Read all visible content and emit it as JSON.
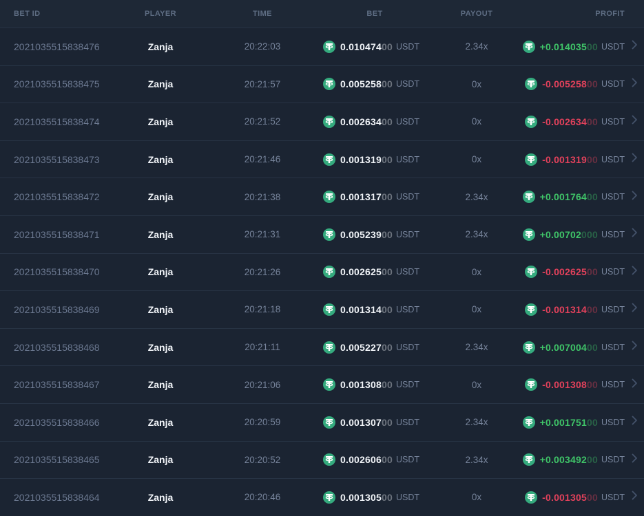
{
  "table": {
    "columns": [
      {
        "key": "bet_id",
        "label": "BET ID"
      },
      {
        "key": "player",
        "label": "PLAYER"
      },
      {
        "key": "time",
        "label": "TIME"
      },
      {
        "key": "bet",
        "label": "BET"
      },
      {
        "key": "payout",
        "label": "PAYOUT"
      },
      {
        "key": "profit",
        "label": "PROFIT"
      }
    ],
    "rows": [
      {
        "id": "2021035515838476",
        "player": "Zanja",
        "time": "20:22:03",
        "bet_main": "0.010474",
        "bet_zeros": "00",
        "payout": "2.34x",
        "profit_main": "+0.014035",
        "profit_zeros": "00",
        "currency": "USDT"
      },
      {
        "id": "2021035515838475",
        "player": "Zanja",
        "time": "20:21:57",
        "bet_main": "0.005258",
        "bet_zeros": "00",
        "payout": "0x",
        "profit_main": "-0.005258",
        "profit_zeros": "00",
        "currency": "USDT"
      },
      {
        "id": "2021035515838474",
        "player": "Zanja",
        "time": "20:21:52",
        "bet_main": "0.002634",
        "bet_zeros": "00",
        "payout": "0x",
        "profit_main": "-0.002634",
        "profit_zeros": "00",
        "currency": "USDT"
      },
      {
        "id": "2021035515838473",
        "player": "Zanja",
        "time": "20:21:46",
        "bet_main": "0.001319",
        "bet_zeros": "00",
        "payout": "0x",
        "profit_main": "-0.001319",
        "profit_zeros": "00",
        "currency": "USDT"
      },
      {
        "id": "2021035515838472",
        "player": "Zanja",
        "time": "20:21:38",
        "bet_main": "0.001317",
        "bet_zeros": "00",
        "payout": "2.34x",
        "profit_main": "+0.001764",
        "profit_zeros": "00",
        "currency": "USDT"
      },
      {
        "id": "2021035515838471",
        "player": "Zanja",
        "time": "20:21:31",
        "bet_main": "0.005239",
        "bet_zeros": "00",
        "payout": "2.34x",
        "profit_main": "+0.00702",
        "profit_zeros": "000",
        "currency": "USDT"
      },
      {
        "id": "2021035515838470",
        "player": "Zanja",
        "time": "20:21:26",
        "bet_main": "0.002625",
        "bet_zeros": "00",
        "payout": "0x",
        "profit_main": "-0.002625",
        "profit_zeros": "00",
        "currency": "USDT"
      },
      {
        "id": "2021035515838469",
        "player": "Zanja",
        "time": "20:21:18",
        "bet_main": "0.001314",
        "bet_zeros": "00",
        "payout": "0x",
        "profit_main": "-0.001314",
        "profit_zeros": "00",
        "currency": "USDT"
      },
      {
        "id": "2021035515838468",
        "player": "Zanja",
        "time": "20:21:11",
        "bet_main": "0.005227",
        "bet_zeros": "00",
        "payout": "2.34x",
        "profit_main": "+0.007004",
        "profit_zeros": "00",
        "currency": "USDT"
      },
      {
        "id": "2021035515838467",
        "player": "Zanja",
        "time": "20:21:06",
        "bet_main": "0.001308",
        "bet_zeros": "00",
        "payout": "0x",
        "profit_main": "-0.001308",
        "profit_zeros": "00",
        "currency": "USDT"
      },
      {
        "id": "2021035515838466",
        "player": "Zanja",
        "time": "20:20:59",
        "bet_main": "0.001307",
        "bet_zeros": "00",
        "payout": "2.34x",
        "profit_main": "+0.001751",
        "profit_zeros": "00",
        "currency": "USDT"
      },
      {
        "id": "2021035515838465",
        "player": "Zanja",
        "time": "20:20:52",
        "bet_main": "0.002606",
        "bet_zeros": "00",
        "payout": "2.34x",
        "profit_main": "+0.003492",
        "profit_zeros": "00",
        "currency": "USDT"
      },
      {
        "id": "2021035515838464",
        "player": "Zanja",
        "time": "20:20:46",
        "bet_main": "0.001305",
        "bet_zeros": "00",
        "payout": "0x",
        "profit_main": "-0.001305",
        "profit_zeros": "00",
        "currency": "USDT"
      }
    ]
  },
  "icons": {
    "currency_icon": "tether-icon",
    "row_action_icon": "chevron-right-icon"
  },
  "colors": {
    "background": "#1b2432",
    "header_background": "#1e2836",
    "separator": "#273344",
    "muted_text": "#76839a",
    "primary_text": "#f1f4f8",
    "profit_positive": "#3fc468",
    "profit_negative": "#e2415b",
    "tether_green": "#35ab7e"
  }
}
